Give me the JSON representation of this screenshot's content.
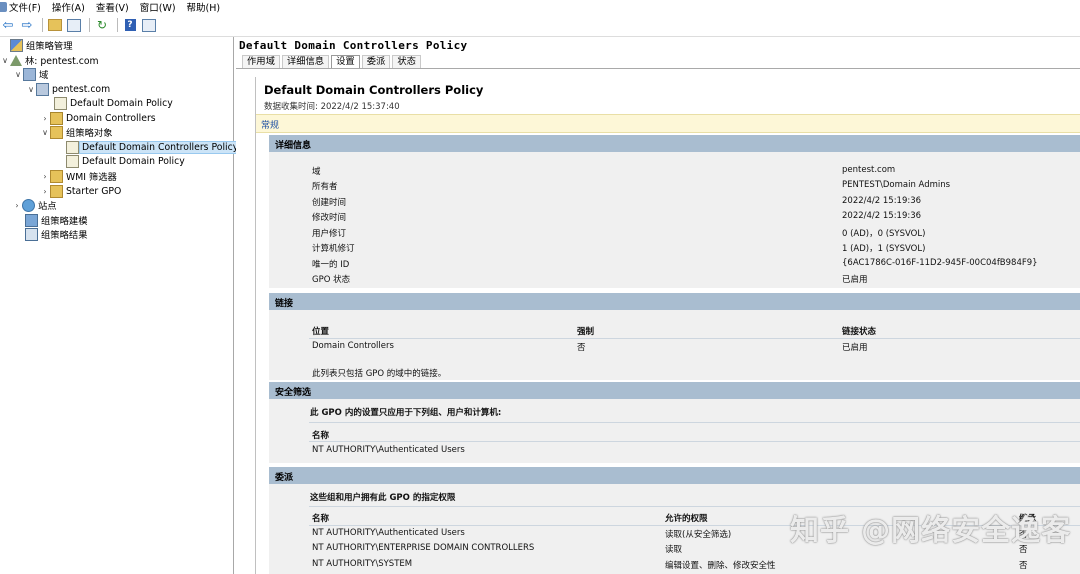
{
  "menubar": {
    "items": [
      "文件(F)",
      "操作(A)",
      "查看(V)",
      "窗口(W)",
      "帮助(H)"
    ]
  },
  "toolbar": {
    "icons": [
      "back-arrow-icon",
      "forward-arrow-icon",
      "folder-up-icon",
      "show-tree-icon",
      "refresh-icon",
      "help-icon",
      "properties-icon"
    ]
  },
  "tree": {
    "root": "组策略管理",
    "forest": "林: pentest.com",
    "domains": "域",
    "domain": "pentest.com",
    "default_domain_policy": "Default Domain Policy",
    "domain_controllers": "Domain Controllers",
    "gpo_folder": "组策略对象",
    "gpo_ddcp": "Default Domain Controllers Policy",
    "gpo_ddp": "Default Domain Policy",
    "wmi": "WMI 筛选器",
    "starter": "Starter GPO",
    "sites": "站点",
    "modeling": "组策略建模",
    "results": "组策略结果"
  },
  "pane": {
    "title": "Default Domain Controllers Policy",
    "tabs": [
      "作用域",
      "详细信息",
      "设置",
      "委派",
      "状态"
    ],
    "active_tab": "设置"
  },
  "report": {
    "title": "Default Domain Controllers Policy",
    "collected": "数据收集时间: 2022/4/2 15:37:40",
    "general": "常规",
    "details": {
      "header": "详细信息",
      "rows": [
        {
          "k": "域",
          "v": "pentest.com"
        },
        {
          "k": "所有者",
          "v": "PENTEST\\Domain Admins"
        },
        {
          "k": "创建时间",
          "v": "2022/4/2 15:19:36"
        },
        {
          "k": "修改时间",
          "v": "2022/4/2 15:19:36"
        },
        {
          "k": "用户修订",
          "v": "0 (AD)，0 (SYSVOL)"
        },
        {
          "k": "计算机修订",
          "v": "1 (AD)，1 (SYSVOL)"
        },
        {
          "k": "唯一的 ID",
          "v": "{6AC1786C-016F-11D2-945F-00C04fB984F9}"
        },
        {
          "k": "GPO 状态",
          "v": "已启用"
        }
      ]
    },
    "links": {
      "header": "链接",
      "col_location": "位置",
      "col_enforced": "强制",
      "col_status": "链接状态",
      "row_location": "Domain Controllers",
      "row_enforced": "否",
      "row_status": "已启用",
      "note": "此列表只包括 GPO 的域中的链接。"
    },
    "security": {
      "header": "安全筛选",
      "desc": "此 GPO 内的设置只应用于下列组、用户和计算机:",
      "col_name": "名称",
      "row_name": "NT AUTHORITY\\Authenticated Users"
    },
    "delegation": {
      "header": "委派",
      "desc": "这些组和用户拥有此 GPO 的指定权限",
      "col_name": "名称",
      "col_perm": "允许的权限",
      "col_inherit": "继承",
      "rows": [
        {
          "name": "NT AUTHORITY\\Authenticated Users",
          "perm": "读取(从安全筛选)",
          "inherit": "否"
        },
        {
          "name": "NT AUTHORITY\\ENTERPRISE DOMAIN CONTROLLERS",
          "perm": "读取",
          "inherit": "否"
        },
        {
          "name": "NT AUTHORITY\\SYSTEM",
          "perm": "编辑设置、删除、修改安全性",
          "inherit": "否"
        }
      ]
    }
  },
  "watermark": "知乎 @网络安全逸客"
}
